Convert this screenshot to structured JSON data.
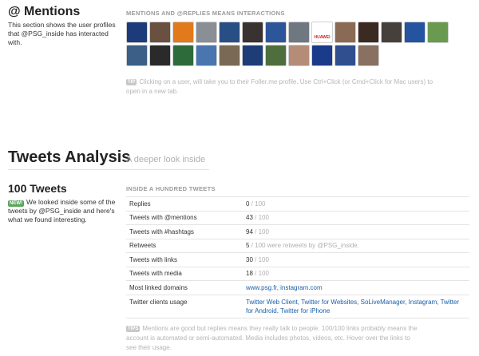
{
  "mentions": {
    "title": "@ Mentions",
    "description": "This section shows the user profiles that @PSG_inside has interacted with.",
    "section_heading": "MENTIONS AND @REPLIES MEANS INTERACTIONS",
    "avatars_row1": [
      {
        "name": "avatar-psg-crest",
        "color": "#1d3b7a",
        "label": ""
      },
      {
        "name": "avatar-bearded-player",
        "color": "#6a5040",
        "label": ""
      },
      {
        "name": "avatar-montpellier-crest",
        "color": "#e07a1a",
        "label": ""
      },
      {
        "name": "avatar-player-white-kit",
        "color": "#8a8f95",
        "label": ""
      },
      {
        "name": "avatar-player-blue-kit",
        "color": "#284e86",
        "label": ""
      },
      {
        "name": "avatar-player-portrait-dark",
        "color": "#3a3230",
        "label": ""
      },
      {
        "name": "avatar-player-stripes",
        "color": "#2d5599",
        "label": ""
      },
      {
        "name": "avatar-player-grey",
        "color": "#6f7780",
        "label": ""
      },
      {
        "name": "avatar-huawei-logo",
        "color": "#ffffff",
        "label": "HUAWEI"
      },
      {
        "name": "avatar-player-smiling",
        "color": "#8a6a55",
        "label": ""
      },
      {
        "name": "avatar-player-dark-skin",
        "color": "#3b2a22",
        "label": ""
      },
      {
        "name": "avatar-player-bald",
        "color": "#46403c",
        "label": ""
      },
      {
        "name": "avatar-player-italy-blue",
        "color": "#2454a0",
        "label": ""
      },
      {
        "name": "avatar-player-green-bg",
        "color": "#6a9a50",
        "label": ""
      }
    ],
    "avatars_row2": [
      {
        "name": "avatar-player-action",
        "color": "#3b5f86",
        "label": ""
      },
      {
        "name": "avatar-logo-circle",
        "color": "#2a2a2a",
        "label": ""
      },
      {
        "name": "avatar-team-group",
        "color": "#2e6b3a",
        "label": ""
      },
      {
        "name": "avatar-player-blue-sky",
        "color": "#4a76b0",
        "label": ""
      },
      {
        "name": "avatar-crowd-photo",
        "color": "#7a6a55",
        "label": ""
      },
      {
        "name": "avatar-player-celebrating",
        "color": "#1e3c78",
        "label": ""
      },
      {
        "name": "avatar-stadium",
        "color": "#4f6e3e",
        "label": ""
      },
      {
        "name": "avatar-woman-portrait",
        "color": "#b48c78",
        "label": ""
      },
      {
        "name": "avatar-inter-crest",
        "color": "#1a3a8a",
        "label": ""
      },
      {
        "name": "avatar-player-runner",
        "color": "#2f4f8f",
        "label": ""
      },
      {
        "name": "avatar-player-long-hair",
        "color": "#8a7060",
        "label": ""
      }
    ],
    "tip_label": "TIP",
    "tip_text": "Clicking on a user, will take you to their Foller.me profile. Use Ctrl+Click (or Cmd+Click for Mac users) to open in a new tab."
  },
  "analysis": {
    "title": "Tweets Analysis",
    "subtitle": "A deeper look inside",
    "count_title": "100 Tweets",
    "new_label": "NEW!",
    "count_description": "We looked inside some of the tweets by @PSG_inside and here's what we found interesting.",
    "section_heading": "INSIDE A HUNDRED TWEETS",
    "rows": [
      {
        "label": "Replies",
        "value": "0",
        "denom": " / 100"
      },
      {
        "label": "Tweets with @mentions",
        "value": "43",
        "denom": " / 100"
      },
      {
        "label": "Tweets with #hashtags",
        "value": "94",
        "denom": " / 100"
      },
      {
        "label": "Retweets",
        "value": "5",
        "denom": " / 100 were retweets by @PSG_inside."
      },
      {
        "label": "Tweets with links",
        "value": "30",
        "denom": " / 100"
      },
      {
        "label": "Tweets with media",
        "value": "18",
        "denom": " / 100"
      }
    ],
    "domains_label": "Most linked domains",
    "domains": [
      "www.psg.fr",
      "instagram.com"
    ],
    "clients_label": "Twitter clients usage",
    "clients": [
      "Twitter Web Client",
      "Twitter for Websites",
      "SoLiveManager",
      "Instagram",
      "Twitter for Android",
      "Twitter for iPhone"
    ],
    "tips_label": "TIPS",
    "tips_text": "Mentions are good but replies means they really talk to people. 100/100 links probably means the account is automated or semi-automated. Media includes photos, videos, etc. Hover over the links to see their usage."
  }
}
